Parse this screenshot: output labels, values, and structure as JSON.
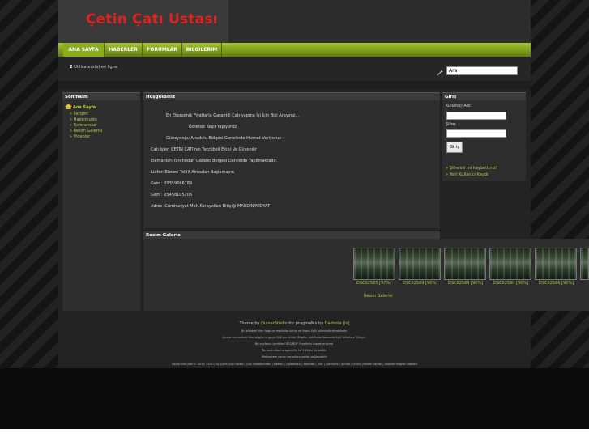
{
  "site": {
    "title": "Çetin Çatı Ustası"
  },
  "nav": {
    "items": [
      "ANA SAYFA",
      "HABERLER",
      "FORUMLAR",
      "BILGILERIM"
    ]
  },
  "info": {
    "online_count": "2",
    "online_text": "Utilisateur(s) en ligne"
  },
  "search": {
    "value": "Ara"
  },
  "sidebar": {
    "title": "Sonmaim",
    "home": "Ana Sayfa",
    "items": [
      "» İletişim",
      "» Hakkımızda",
      "» Referanslar",
      "» Resim Galerisi",
      "» Videolar"
    ]
  },
  "welcome": {
    "title": "Hoşgeldiniz",
    "lines": [
      "En Ekonomik Fiyatlarla Garantili Çatı yapma İşi İçin Bizi Arayınız...",
      "Ücretsiz Keşif Yapıyoruz,",
      "Güneydoğu Anadolu Bölgesi Genelinde Hizmet Veriyoruz",
      "Çatı işleri ÇETİN ÇATI'nın Tecrübeli Ekibi Ve Güvenilir",
      "Elemanları Tarafından Garanti Belgesi Dahilinde Yapılmaktadır.",
      "Lütfen Bizden Teklif Almadan Başlamayın",
      "Gsm : 05359666789",
      "Gsm : 05458105206",
      "Adres :Cumhuriyet Mah.Karayolları Bitişiği   MARDİN/MİDYAT"
    ]
  },
  "gallery": {
    "title": "Resim Galerisi",
    "thumbs": [
      "DSC02585 [97%]",
      "DSC02589 [90%]",
      "DSC02588 [90%]",
      "DSC02590 [90%]",
      "DSC02586 [90%]"
    ],
    "link": "Resim Galerisi"
  },
  "login": {
    "title": "Giriş",
    "username_label": "Kullanıcı Adı:",
    "password_label": "Şifre:",
    "button": "Giriş",
    "forgot": "» Şifrenizi mi kaybettiniz?",
    "register": "» Yeni Kullanıcı Kaydı"
  },
  "footer": {
    "theme_prefix": "Theme by",
    "theme_author": "DuinerStudio",
    "theme_middle": "for pragmaMx by",
    "theme_by": "Dadsota",
    "theme_tag": "[lo]",
    "lines": [
      "Bu sitedeki tüm logo ve markalar sahip ve lisans ilgili ailenizdir olmaktadır.",
      "Ayrıca sunumdaki tüm bilgilerin geçerliliği gereklidir. Bilgiler dahilinde ilanınızla ilgili bilimlere Ekleyin.",
      "Bu sayfanın içerikleri RSS/RDF Feyeddiri olarak erişime.",
      "Bu web sitesi pragmaMx ile 1.10 ile deyebilir.",
      "Makinelere yaran yaparlara sahibi sağlayabilir.",
      "Sayfa tüm yazı © 2010 - 2011 by Çetin Çatı Ustası | Çatı Ustalarından | Mardin | Diyarbakır | Batman | Siirt | Şanlıurfa | Şırnak | DSMX yüksek çatılar | Kaynak Midyat Ustaları"
    ]
  },
  "colors": {
    "accent": "#b8c94a",
    "brand": "#e0211d",
    "nav": "#7fa21a"
  }
}
